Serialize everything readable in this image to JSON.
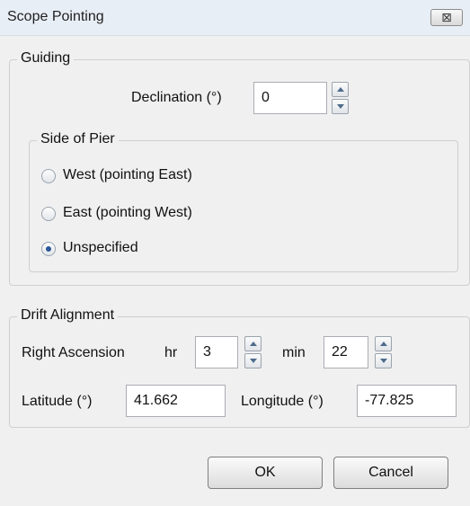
{
  "window": {
    "title": "Scope Pointing",
    "close_glyph": "⊠"
  },
  "guiding": {
    "title": "Guiding",
    "declination_label": "Declination (°)",
    "declination_value": "0",
    "side_of_pier": {
      "title": "Side of Pier",
      "options": [
        {
          "label": "West (pointing East)",
          "selected": false
        },
        {
          "label": "East (pointing West)",
          "selected": false
        },
        {
          "label": "Unspecified",
          "selected": true
        }
      ]
    }
  },
  "drift_alignment": {
    "title": "Drift Alignment",
    "ra_label": "Right Ascension",
    "hr_label": "hr",
    "hr_value": "3",
    "min_label": "min",
    "min_value": "22",
    "latitude_label": "Latitude (°)",
    "latitude_value": "41.662",
    "longitude_label": "Longitude (°)",
    "longitude_value": "-77.825"
  },
  "buttons": {
    "ok": "OK",
    "cancel": "Cancel"
  },
  "icons": {
    "close": "close-icon",
    "spin_up": "arrow-up-icon",
    "spin_down": "arrow-down-icon",
    "radio": "radio-icon"
  }
}
